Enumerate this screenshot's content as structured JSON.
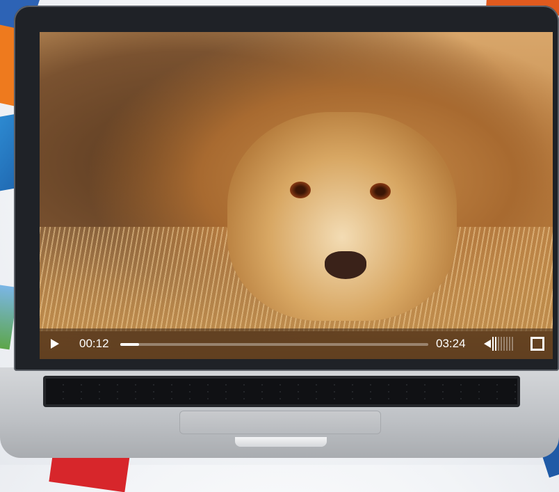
{
  "player": {
    "current_time": "00:12",
    "duration": "03:24",
    "progress_fraction": 0.06,
    "volume_level_fraction": 0.25
  },
  "icons": {
    "play": "play-icon",
    "volume": "volume-icon",
    "fullscreen": "fullscreen-icon"
  },
  "colors": {
    "control_bar": "#3c2819",
    "laptop_bezel": "#1f2227"
  }
}
